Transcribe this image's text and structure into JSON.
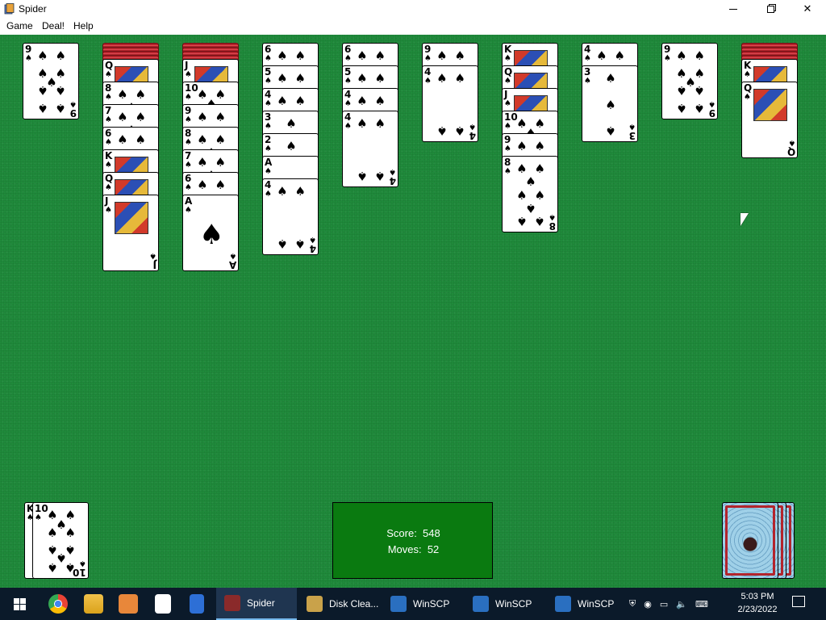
{
  "window": {
    "title": "Spider"
  },
  "menu": {
    "items": [
      "Game",
      "Deal!",
      "Help"
    ]
  },
  "tableau": [
    {
      "face_down": 0,
      "cards": [
        {
          "rank": "9",
          "suit": "♠"
        }
      ]
    },
    {
      "face_down": 4,
      "cards": [
        {
          "rank": "Q",
          "suit": "♠"
        },
        {
          "rank": "8",
          "suit": "♠"
        },
        {
          "rank": "7",
          "suit": "♠"
        },
        {
          "rank": "6",
          "suit": "♠"
        },
        {
          "rank": "K",
          "suit": "♠"
        },
        {
          "rank": "Q",
          "suit": "♠"
        },
        {
          "rank": "J",
          "suit": "♠"
        }
      ]
    },
    {
      "face_down": 4,
      "cards": [
        {
          "rank": "J",
          "suit": "♠"
        },
        {
          "rank": "10",
          "suit": "♠"
        },
        {
          "rank": "9",
          "suit": "♠"
        },
        {
          "rank": "8",
          "suit": "♠"
        },
        {
          "rank": "7",
          "suit": "♠"
        },
        {
          "rank": "6",
          "suit": "♠"
        },
        {
          "rank": "A",
          "suit": "♠"
        }
      ]
    },
    {
      "face_down": 0,
      "cards": [
        {
          "rank": "6",
          "suit": "♠"
        },
        {
          "rank": "5",
          "suit": "♠"
        },
        {
          "rank": "4",
          "suit": "♠"
        },
        {
          "rank": "3",
          "suit": "♠"
        },
        {
          "rank": "2",
          "suit": "♠"
        },
        {
          "rank": "A",
          "suit": "♠"
        },
        {
          "rank": "4",
          "suit": "♠"
        }
      ]
    },
    {
      "face_down": 0,
      "cards": [
        {
          "rank": "6",
          "suit": "♠"
        },
        {
          "rank": "5",
          "suit": "♠"
        },
        {
          "rank": "4",
          "suit": "♠"
        },
        {
          "rank": "4",
          "suit": "♠"
        }
      ]
    },
    {
      "face_down": 0,
      "cards": [
        {
          "rank": "9",
          "suit": "♠"
        },
        {
          "rank": "4",
          "suit": "♠"
        }
      ]
    },
    {
      "face_down": 0,
      "cards": [
        {
          "rank": "K",
          "suit": "♠"
        },
        {
          "rank": "Q",
          "suit": "♠"
        },
        {
          "rank": "J",
          "suit": "♠"
        },
        {
          "rank": "10",
          "suit": "♠"
        },
        {
          "rank": "9",
          "suit": "♠"
        },
        {
          "rank": "8",
          "suit": "♠"
        }
      ]
    },
    {
      "face_down": 0,
      "cards": [
        {
          "rank": "4",
          "suit": "♠"
        },
        {
          "rank": "3",
          "suit": "♠"
        }
      ]
    },
    {
      "face_down": 0,
      "cards": [
        {
          "rank": "9",
          "suit": "♠"
        }
      ]
    },
    {
      "face_down": 4,
      "cards": [
        {
          "rank": "K",
          "suit": "♠"
        },
        {
          "rank": "Q",
          "suit": "♠"
        }
      ]
    }
  ],
  "foundation": {
    "completed": [
      {
        "top_rank": "K",
        "second_rank": "10",
        "suit": "♠"
      }
    ]
  },
  "status": {
    "score_label": "Score:",
    "score": "548",
    "moves_label": "Moves:",
    "moves": "52"
  },
  "stock": {
    "piles": 3
  },
  "taskbar": {
    "items": [
      {
        "label": "Spider",
        "active": true
      },
      {
        "label": "Disk Clea...",
        "active": false
      },
      {
        "label": "WinSCP",
        "active": false
      },
      {
        "label": "WinSCP",
        "active": false
      },
      {
        "label": "WinSCP",
        "active": false
      }
    ],
    "time": "5:03 PM",
    "date": "2/23/2022"
  },
  "colors": {
    "felt": "#1f8a3b",
    "score_box": "#0a7a10",
    "card_back": "#b3242c",
    "taskbar": "#0b1a2a"
  }
}
